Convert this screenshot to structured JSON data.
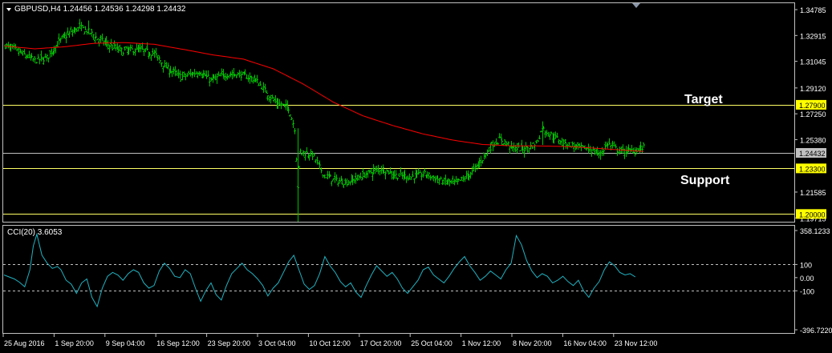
{
  "header": {
    "symbol_line": "GBPUSD,H4  1.24456 1.24536 1.24298 1.24432"
  },
  "indicator": {
    "label": "CCI(20) 3.6053"
  },
  "annotations": {
    "target": "Target",
    "support": "Support"
  },
  "colors": {
    "background": "#000000",
    "frame": "#c0c0c0",
    "bars": "#00c000",
    "moving_average": "#ff0000",
    "level_lines": "#ffff66",
    "bid_line": "#c0c0c0",
    "cci_line": "#20b2c0",
    "axis_text": "#ffffff",
    "level_label_bg": "#ffff00"
  },
  "chart_data": [
    {
      "type": "ohlc",
      "symbol": "GBPUSD",
      "timeframe": "H4",
      "ohlc_header": {
        "open": 1.24456,
        "high": 1.24536,
        "low": 1.24298,
        "close": 1.24432
      },
      "ylim": [
        1.1944,
        1.3525
      ],
      "y_ticks": [
        "1.34785",
        "1.32915",
        "1.31045",
        "1.29120",
        "1.27250",
        "1.25380",
        "1.21585",
        "1.19715"
      ],
      "x_ticks": [
        "25 Aug 2016",
        "1 Sep 20:00",
        "9 Sep 04:00",
        "16 Sep 12:00",
        "23 Sep 20:00",
        "3 Oct 04:00",
        "10 Oct 12:00",
        "17 Oct 20:00",
        "25 Oct 04:00",
        "1 Nov 12:00",
        "8 Nov 20:00",
        "16 Nov 04:00",
        "23 Nov 12:00"
      ],
      "bar_count": 510,
      "close_path": [
        [
          0,
          1.322
        ],
        [
          10,
          1.317
        ],
        [
          20,
          1.311
        ],
        [
          28,
          1.313
        ],
        [
          38,
          1.327
        ],
        [
          50,
          1.335
        ],
        [
          56,
          1.332
        ],
        [
          62,
          1.327
        ],
        [
          70,
          1.322
        ],
        [
          78,
          1.318
        ],
        [
          90,
          1.319
        ],
        [
          100,
          1.316
        ],
        [
          108,
          1.306
        ],
        [
          118,
          1.299
        ],
        [
          130,
          1.303
        ],
        [
          138,
          1.297
        ],
        [
          148,
          1.301
        ],
        [
          158,
          1.301
        ],
        [
          168,
          1.297
        ],
        [
          176,
          1.287
        ],
        [
          182,
          1.28
        ],
        [
          190,
          1.277
        ],
        [
          194,
          1.262
        ],
        [
          196,
          1.22
        ],
        [
          198,
          1.245
        ],
        [
          206,
          1.243
        ],
        [
          214,
          1.228
        ],
        [
          222,
          1.224
        ],
        [
          230,
          1.223
        ],
        [
          240,
          1.228
        ],
        [
          252,
          1.233
        ],
        [
          262,
          1.228
        ],
        [
          272,
          1.227
        ],
        [
          282,
          1.229
        ],
        [
          292,
          1.224
        ],
        [
          302,
          1.222
        ],
        [
          312,
          1.229
        ],
        [
          320,
          1.24
        ],
        [
          326,
          1.25
        ],
        [
          332,
          1.254
        ],
        [
          340,
          1.248
        ],
        [
          348,
          1.247
        ],
        [
          356,
          1.251
        ],
        [
          360,
          1.262
        ],
        [
          366,
          1.257
        ],
        [
          374,
          1.252
        ],
        [
          384,
          1.248
        ],
        [
          392,
          1.247
        ],
        [
          398,
          1.243
        ],
        [
          404,
          1.251
        ],
        [
          412,
          1.245
        ],
        [
          420,
          1.246
        ],
        [
          428,
          1.248
        ]
      ],
      "wicks": [
        {
          "bar": 196,
          "low": 1.1945,
          "high": 1.262
        },
        {
          "bar": 56,
          "low": 1.33,
          "high": 1.34
        },
        {
          "bar": 360,
          "low": 1.25,
          "high": 1.267
        }
      ],
      "moving_average": {
        "points": [
          [
            0,
            1.3215
          ],
          [
            20,
            1.3195
          ],
          [
            40,
            1.321
          ],
          [
            60,
            1.3235
          ],
          [
            80,
            1.324
          ],
          [
            100,
            1.3228
          ],
          [
            120,
            1.319
          ],
          [
            140,
            1.315
          ],
          [
            160,
            1.312
          ],
          [
            180,
            1.305
          ],
          [
            200,
            1.294
          ],
          [
            220,
            1.281
          ],
          [
            240,
            1.271
          ],
          [
            260,
            1.264
          ],
          [
            280,
            1.258
          ],
          [
            300,
            1.2535
          ],
          [
            320,
            1.2503
          ],
          [
            340,
            1.2493
          ],
          [
            360,
            1.2492
          ],
          [
            380,
            1.2487
          ],
          [
            400,
            1.2473
          ],
          [
            420,
            1.2458
          ],
          [
            428,
            1.2453
          ]
        ]
      },
      "levels": [
        {
          "price": 1.279,
          "label": "1.27900"
        },
        {
          "price": 1.233,
          "label": "1.23300"
        },
        {
          "price": 1.2,
          "label": "1.20000"
        }
      ],
      "bid": {
        "price": 1.24432,
        "label": "1.24432"
      }
    },
    {
      "type": "line",
      "name": "CCI(20)",
      "current": 3.6053,
      "ylim": [
        -396.722,
        358.1233
      ],
      "y_ticks": [
        "358.1233",
        "100",
        "0.00",
        "-100",
        "-396.7220"
      ],
      "levels": [
        100,
        -100
      ],
      "points": [
        [
          0,
          20
        ],
        [
          6,
          5
        ],
        [
          12,
          -10
        ],
        [
          18,
          -35
        ],
        [
          24,
          -70
        ],
        [
          30,
          60
        ],
        [
          34,
          240
        ],
        [
          38,
          330
        ],
        [
          44,
          170
        ],
        [
          50,
          110
        ],
        [
          56,
          70
        ],
        [
          62,
          85
        ],
        [
          66,
          60
        ],
        [
          72,
          -20
        ],
        [
          78,
          -50
        ],
        [
          84,
          -120
        ],
        [
          90,
          -40
        ],
        [
          96,
          -10
        ],
        [
          102,
          -150
        ],
        [
          108,
          -220
        ],
        [
          114,
          -80
        ],
        [
          120,
          10
        ],
        [
          126,
          40
        ],
        [
          132,
          20
        ],
        [
          138,
          -20
        ],
        [
          144,
          30
        ],
        [
          150,
          60
        ],
        [
          156,
          40
        ],
        [
          162,
          -40
        ],
        [
          168,
          -80
        ],
        [
          174,
          -60
        ],
        [
          180,
          50
        ],
        [
          186,
          110
        ],
        [
          192,
          70
        ],
        [
          198,
          10
        ],
        [
          204,
          0
        ],
        [
          210,
          60
        ],
        [
          216,
          30
        ],
        [
          222,
          -80
        ],
        [
          228,
          -180
        ],
        [
          234,
          -100
        ],
        [
          240,
          -40
        ],
        [
          246,
          -130
        ],
        [
          252,
          -170
        ],
        [
          258,
          -60
        ],
        [
          264,
          30
        ],
        [
          270,
          70
        ],
        [
          276,
          110
        ],
        [
          282,
          60
        ],
        [
          288,
          30
        ],
        [
          294,
          -10
        ],
        [
          300,
          -60
        ],
        [
          306,
          -140
        ],
        [
          312,
          -80
        ],
        [
          318,
          -40
        ],
        [
          324,
          40
        ],
        [
          330,
          120
        ],
        [
          336,
          170
        ],
        [
          342,
          60
        ],
        [
          348,
          -50
        ],
        [
          354,
          -90
        ],
        [
          360,
          -60
        ],
        [
          366,
          30
        ],
        [
          372,
          160
        ],
        [
          378,
          90
        ],
        [
          384,
          40
        ],
        [
          390,
          -30
        ],
        [
          396,
          -70
        ],
        [
          402,
          -40
        ],
        [
          408,
          -110
        ],
        [
          414,
          -150
        ],
        [
          420,
          -60
        ],
        [
          426,
          20
        ],
        [
          432,
          90
        ],
        [
          438,
          50
        ],
        [
          444,
          10
        ],
        [
          450,
          40
        ],
        [
          456,
          -10
        ],
        [
          462,
          -80
        ],
        [
          468,
          -120
        ],
        [
          474,
          -70
        ],
        [
          480,
          -20
        ],
        [
          486,
          60
        ],
        [
          492,
          80
        ],
        [
          498,
          20
        ],
        [
          504,
          -10
        ],
        [
          510,
          -40
        ],
        [
          516,
          10
        ],
        [
          522,
          70
        ],
        [
          528,
          120
        ],
        [
          534,
          160
        ],
        [
          540,
          90
        ],
        [
          546,
          40
        ],
        [
          552,
          -20
        ],
        [
          558,
          10
        ],
        [
          564,
          50
        ],
        [
          570,
          20
        ],
        [
          576,
          -10
        ],
        [
          582,
          60
        ],
        [
          588,
          110
        ],
        [
          594,
          320
        ],
        [
          600,
          250
        ],
        [
          606,
          130
        ],
        [
          612,
          50
        ],
        [
          618,
          0
        ],
        [
          624,
          30
        ],
        [
          630,
          10
        ],
        [
          636,
          -40
        ],
        [
          642,
          -20
        ],
        [
          648,
          10
        ],
        [
          654,
          -30
        ],
        [
          660,
          -60
        ],
        [
          666,
          -20
        ],
        [
          672,
          -100
        ],
        [
          678,
          -150
        ],
        [
          684,
          -80
        ],
        [
          690,
          -30
        ],
        [
          696,
          60
        ],
        [
          702,
          120
        ],
        [
          708,
          90
        ],
        [
          714,
          40
        ],
        [
          720,
          20
        ],
        [
          726,
          30
        ],
        [
          732,
          5
        ]
      ]
    }
  ]
}
